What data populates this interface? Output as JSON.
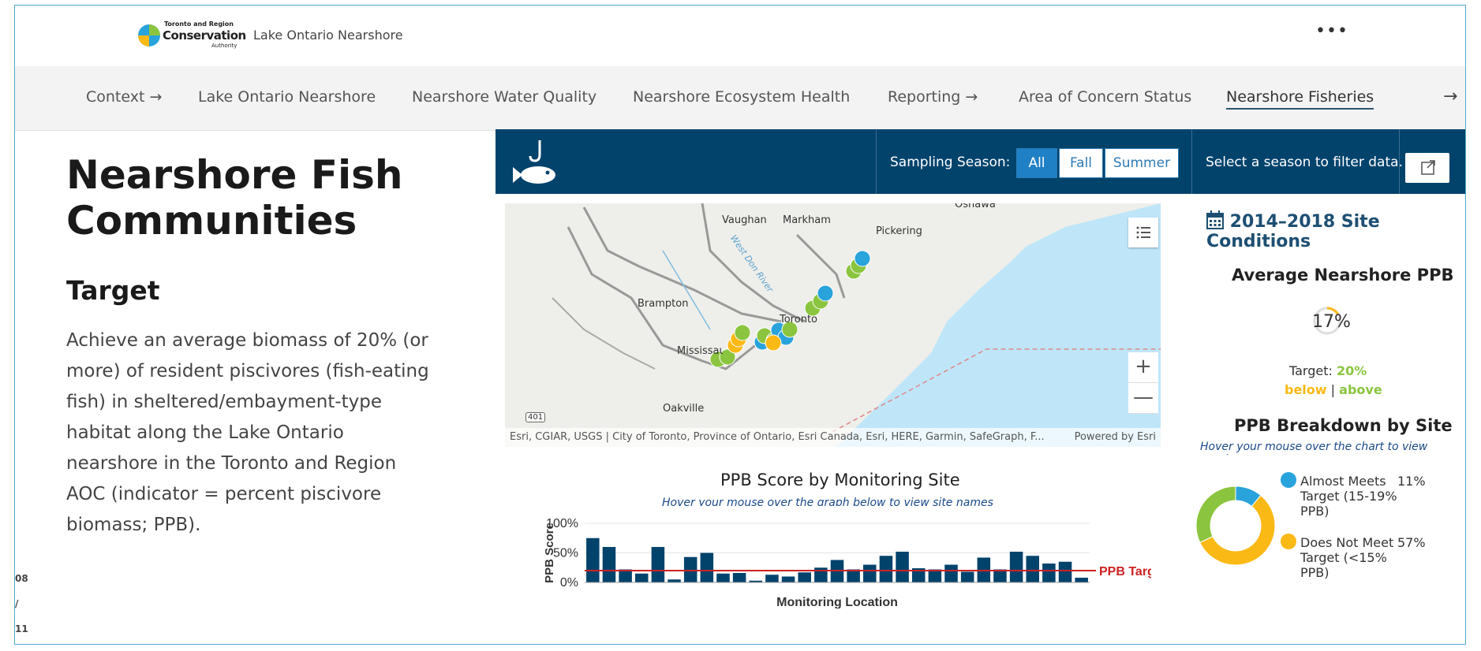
{
  "header": {
    "logo_line1": "Toronto and Region",
    "logo_line2": "Conservation",
    "logo_line3": "Authority",
    "site_title": "Lake Ontario Nearshore",
    "more_icon": "•••"
  },
  "nav": {
    "items": [
      {
        "label": "Context →"
      },
      {
        "label": "Lake Ontario Nearshore"
      },
      {
        "label": "Nearshore Water Quality"
      },
      {
        "label": "Nearshore Ecosystem Health"
      },
      {
        "label": "Reporting →"
      },
      {
        "label": "Area of Concern Status"
      },
      {
        "label": "Nearshore Fisheries"
      }
    ],
    "next_arrow": "→"
  },
  "page": {
    "title_line1": "Nearshore Fish",
    "title_line2": "Communities",
    "section": "Target",
    "paragraph": "Achieve an average biomass of 20% (or more) of resident piscivores (fish-eating fish) in sheltered/embayment-type habitat along the Lake Ontario nearshore in the Toronto and Region AOC (indicator = percent piscivore biomass; PPB).",
    "date_parts": [
      "08",
      "/",
      "11"
    ]
  },
  "dashboard": {
    "season_label": "Sampling Season:",
    "season_options": [
      "All",
      "Fall",
      "Summer"
    ],
    "selected_season": "All",
    "filter_note": "Select a season to filter data."
  },
  "map": {
    "labels": [
      "Oshawa",
      "Vaughan",
      "Markham",
      "Pickering",
      "West Don River",
      "Brampton",
      "Toronto",
      "Mississauga",
      "Oakville",
      "401"
    ],
    "attribution": "Esri, CGIAR, USGS | City of Toronto, Province of Ontario, Esri Canada, Esri, HERE, Garmin, SafeGraph, F...",
    "powered_by": "Powered by Esri",
    "zoom_in": "+",
    "zoom_out": "—"
  },
  "bar_chart_text": {
    "title": "PPB Score by Monitoring Site",
    "subtitle": "Hover your mouse over the graph below to view site names"
  },
  "chart_data": [
    {
      "type": "bar",
      "title": "PPB Score by Monitoring Site",
      "xlabel": "Monitoring Location",
      "ylabel": "PPB Score",
      "ylim": [
        0,
        100
      ],
      "yticks": [
        "100%",
        "50%",
        "0%"
      ],
      "values": [
        75,
        60,
        22,
        15,
        60,
        5,
        43,
        50,
        15,
        16,
        3,
        13,
        10,
        17,
        25,
        38,
        22,
        30,
        45,
        52,
        24,
        22,
        30,
        18,
        42,
        22,
        52,
        45,
        32,
        35,
        8
      ],
      "reference_line": {
        "label": "PPB Target",
        "value": 20,
        "color": "#cc2222"
      },
      "bar_color": "#02436c"
    },
    {
      "type": "pie",
      "title": "PPB Breakdown by Site",
      "subtitle": "Hover your mouse over the chart to view number",
      "series": [
        {
          "name": "Almost Meets Target (15-19% PPB)",
          "value": 11,
          "label": "11%",
          "color": "#29a3dc"
        },
        {
          "name": "Does Not Meet Target (<15% PPB)",
          "value": 57,
          "label": "57%",
          "color": "#fbb916"
        },
        {
          "value": 32,
          "color": "#8bc53f"
        }
      ]
    }
  ],
  "right_panel": {
    "title": "2014–2018 Site Conditions",
    "avg_title": "Average Nearshore PPB",
    "avg_value": "17%",
    "avg_fraction": 0.17,
    "target_label": "Target:",
    "target_value": "20%",
    "below": "below",
    "divider": "|",
    "above": "above",
    "legend": [
      {
        "lines": [
          "Almost Meets",
          "Target (15-19%",
          "PPB)"
        ],
        "pct": "11%",
        "color": "#29a3dc"
      },
      {
        "lines": [
          "Does Not Meet",
          "Target (<15%",
          "PPB)"
        ],
        "pct": "57%",
        "color": "#fbb916"
      }
    ]
  },
  "colors": {
    "dashboard_header": "#02436c",
    "accent_blue": "#1f80c5",
    "green": "#8bc53f",
    "orange": "#fbb916",
    "blue_site": "#29a3dc",
    "water": "#bfe6f8"
  }
}
